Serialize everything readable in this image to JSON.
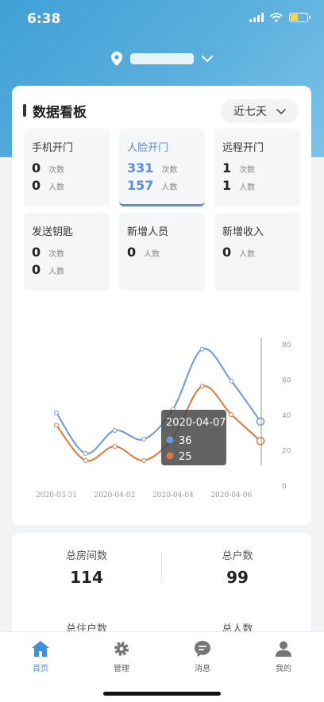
{
  "status_bar": {
    "time": "6:38"
  },
  "location": {
    "name": ""
  },
  "dashboard": {
    "title": "数据看板",
    "range": "近七天",
    "tiles": [
      {
        "name": "手机开门",
        "count": "0",
        "count_unit": "次数",
        "people": "0",
        "people_unit": "人数"
      },
      {
        "name": "人脸开门",
        "count": "331",
        "count_unit": "次数",
        "people": "157",
        "people_unit": "人数"
      },
      {
        "name": "远程开门",
        "count": "1",
        "count_unit": "次数",
        "people": "1",
        "people_unit": "人数"
      },
      {
        "name": "发送钥匙",
        "count": "0",
        "count_unit": "次数",
        "people": "0",
        "people_unit": "人数"
      },
      {
        "name": "新增人员",
        "count": "0",
        "count_unit": "人数"
      },
      {
        "name": "新增收入",
        "count": "0",
        "count_unit": "人数"
      }
    ]
  },
  "chart_data": {
    "type": "line",
    "x": [
      "2020-03-31",
      "2020-04-01",
      "2020-04-02",
      "2020-04-03",
      "2020-04-04",
      "2020-04-05",
      "2020-04-06",
      "2020-04-07"
    ],
    "x_tick_labels": [
      "2020-03-31",
      "2020-04-02",
      "2020-04-04",
      "2020-04-06"
    ],
    "series": [
      {
        "values": [
          41,
          18,
          31,
          26,
          43,
          77,
          59,
          36
        ],
        "color": "#6a99dc"
      },
      {
        "values": [
          34,
          14,
          22,
          14,
          27,
          56,
          40,
          25
        ],
        "color": "#e0763a"
      }
    ],
    "y_ticks": [
      0,
      20,
      40,
      60,
      80
    ],
    "ylim": [
      0,
      80
    ],
    "axis_side": "right",
    "tooltip": {
      "date": "2020-04-07",
      "values": [
        "36",
        "25"
      ]
    }
  },
  "stats": [
    {
      "label": "总房间数",
      "value": "114"
    },
    {
      "label": "总户数",
      "value": "99"
    },
    {
      "label": "总住户数"
    },
    {
      "label": "总人数"
    }
  ],
  "tabs": [
    {
      "label": "首页",
      "icon": "home-icon",
      "active": true
    },
    {
      "label": "管理",
      "icon": "gear-icon"
    },
    {
      "label": "消息",
      "icon": "message-icon"
    },
    {
      "label": "我的",
      "icon": "user-icon"
    }
  ],
  "colors": {
    "accent": "#3d8fe0",
    "tile_active": "#5b8fd9",
    "series_blue": "#6a99dc",
    "series_orange": "#e0763a"
  }
}
